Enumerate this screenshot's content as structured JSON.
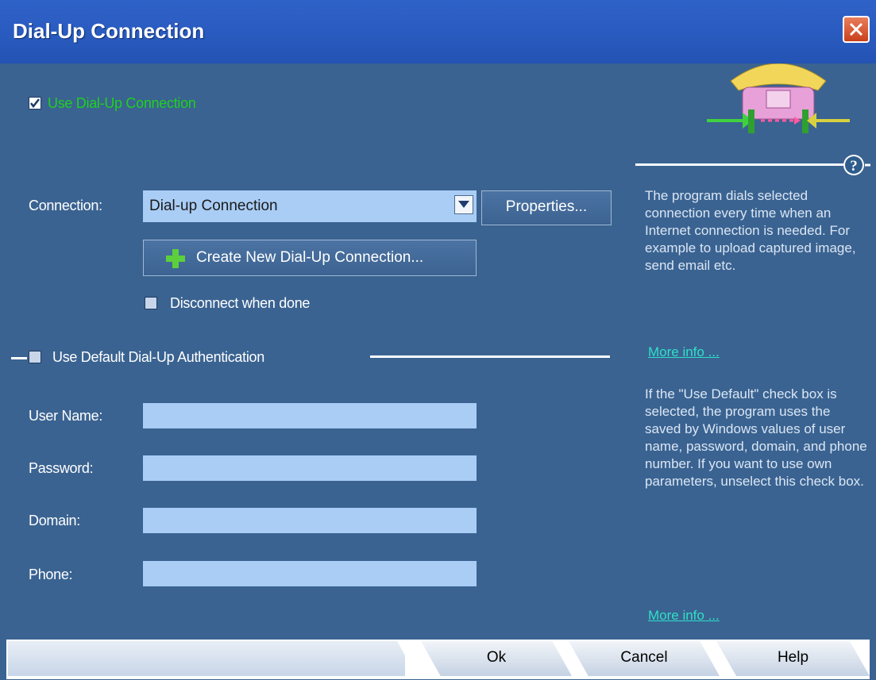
{
  "window": {
    "title": "Dial-Up Connection"
  },
  "use_dialup": {
    "label": "Use Dial-Up Connection",
    "checked": true
  },
  "connection": {
    "label": "Connection:",
    "selected": "Dial-up Connection",
    "properties_label": "Properties...",
    "create_label": "Create New Dial-Up Connection..."
  },
  "disconnect": {
    "label": "Disconnect when done",
    "checked": false
  },
  "auth": {
    "label": "Use Default Dial-Up Authentication",
    "checked": false,
    "fields": [
      {
        "label": "User Name:",
        "value": ""
      },
      {
        "label": "Password:",
        "value": ""
      },
      {
        "label": "Domain:",
        "value": ""
      },
      {
        "label": "Phone:",
        "value": ""
      }
    ]
  },
  "help": {
    "icon": "question-icon",
    "text1": "The program dials selected connection every time when an Internet connection is needed. For example to upload captured image, send email etc.",
    "more_info_1": "More info ...",
    "text2": "If the \"Use Default\" check box is selected, the program uses the saved by Windows values of user name, password, domain, and phone number. If you want to use own parameters, unselect this check box.",
    "more_info_2": "More info ..."
  },
  "footer": {
    "ok_label": "Ok",
    "cancel_label": "Cancel",
    "help_label": "Help"
  },
  "colors": {
    "background": "#3a6391",
    "title_bar": "#2a5bc0",
    "field": "#a9cdf5",
    "checkbox_label_green": "#20d020",
    "link": "#2fe0c8"
  }
}
